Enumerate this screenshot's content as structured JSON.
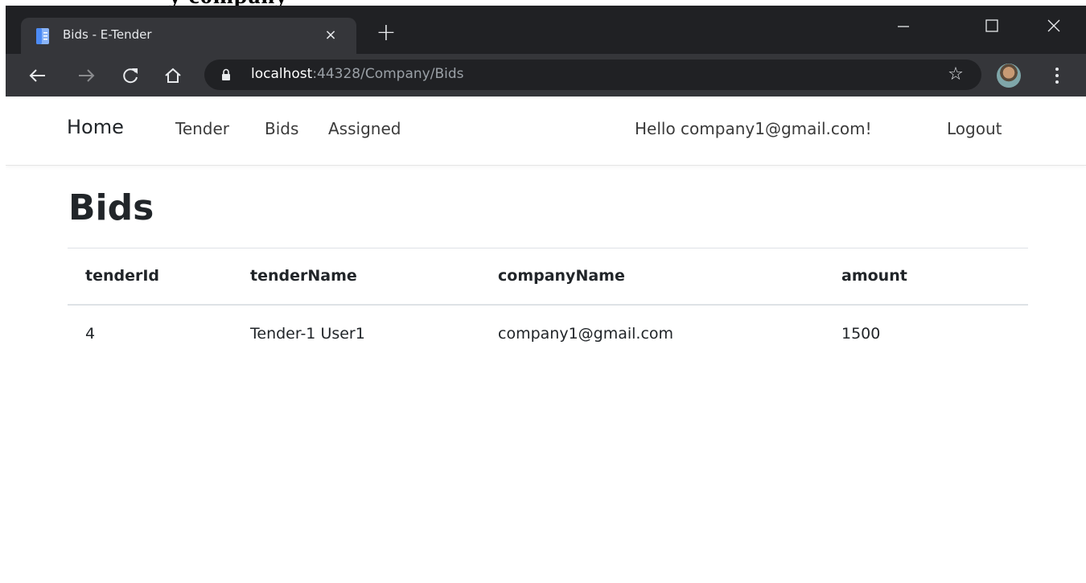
{
  "background_document": {
    "text": "y  company"
  },
  "browser": {
    "tab": {
      "title": "Bids - E-Tender",
      "close_glyph": "×"
    },
    "new_tab_glyph": "+",
    "window_controls": {
      "minimize": "–",
      "maximize": "□",
      "close": "✕"
    },
    "toolbar": {
      "back_glyph": "←",
      "forward_glyph": "→",
      "reload_glyph": "⟳",
      "home_glyph": "⌂",
      "star_glyph": "☆"
    },
    "address_bar": {
      "host": "localhost",
      "rest": ":44328/Company/Bids"
    }
  },
  "navbar": {
    "brand": "Home",
    "links": {
      "tender": "Tender",
      "bids": "Bids",
      "assigned": "Assigned"
    },
    "greeting": "Hello company1@gmail.com!",
    "logout": "Logout"
  },
  "main": {
    "title": "Bids",
    "table": {
      "headers": [
        "tenderId",
        "tenderName",
        "companyName",
        "amount"
      ],
      "rows": [
        [
          "4",
          "Tender-1 User1",
          "company1@gmail.com",
          "1500"
        ]
      ]
    }
  },
  "colors": {
    "tab_strip": "#202124",
    "toolbar": "#35363a",
    "omnibox": "#202124",
    "text_dark": "#212529"
  }
}
